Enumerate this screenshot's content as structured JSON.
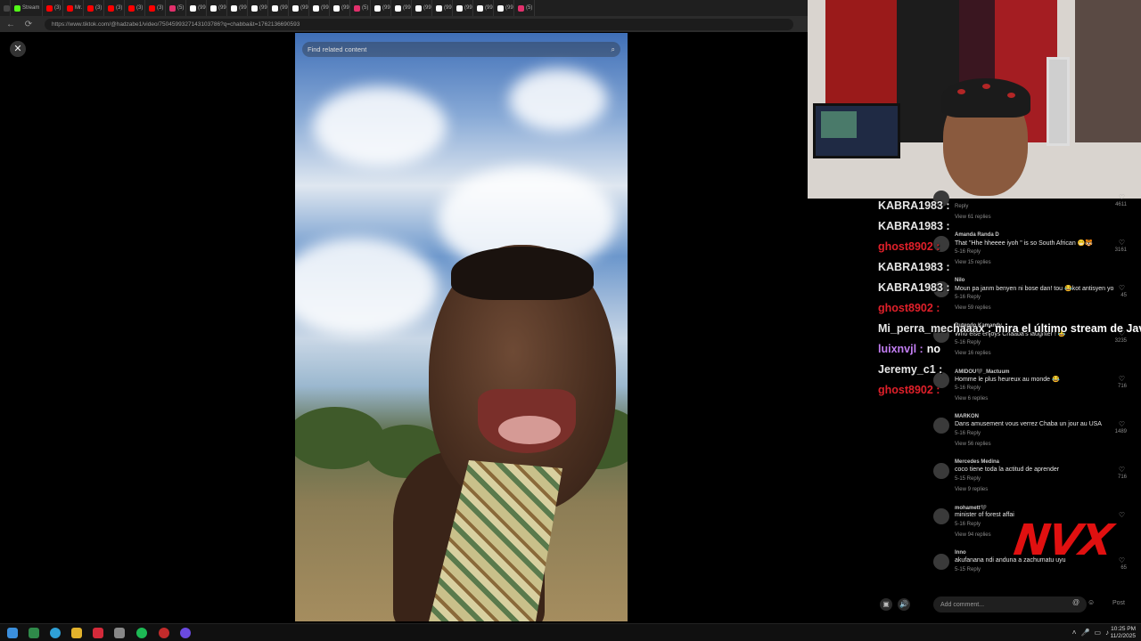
{
  "browser": {
    "tabs": [
      {
        "label": "",
        "icon": "menu-icon",
        "color": "#444444"
      },
      {
        "label": "Stream",
        "icon": "kick-icon",
        "color": "#53fc18"
      },
      {
        "label": "(3) Har",
        "icon": "youtube-icon",
        "color": "#ff0000"
      },
      {
        "label": "Mr.",
        "icon": "youtube-icon",
        "color": "#ff0000"
      },
      {
        "label": "(3) BLA",
        "icon": "youtube-icon",
        "color": "#ff0000"
      },
      {
        "label": "(3) BAE",
        "icon": "youtube-icon",
        "color": "#ff0000"
      },
      {
        "label": "(3) [FR",
        "icon": "youtube-icon",
        "color": "#ff0000"
      },
      {
        "label": "(3) Get",
        "icon": "youtube-icon",
        "color": "#ff0000"
      },
      {
        "label": "(5) Inst",
        "icon": "instagram-icon",
        "color": "#e1306c"
      },
      {
        "label": "(99+) c",
        "icon": "tiktok-icon",
        "color": "#ffffff"
      },
      {
        "label": "(99+)",
        "icon": "tiktok-icon",
        "color": "#ffffff"
      },
      {
        "label": "(99+) E",
        "icon": "tiktok-icon",
        "color": "#ffffff"
      },
      {
        "label": "(99+) E",
        "icon": "tiktok-icon",
        "color": "#ffffff"
      },
      {
        "label": "(99+)",
        "icon": "tiktok-icon",
        "color": "#ffffff"
      },
      {
        "label": "(99+) E",
        "icon": "tiktok-icon",
        "color": "#ffffff"
      },
      {
        "label": "(99+) L",
        "icon": "tiktok-icon",
        "color": "#ffffff"
      },
      {
        "label": "(99+) W",
        "icon": "tiktok-icon",
        "color": "#ffffff"
      },
      {
        "label": "(5) Inst",
        "icon": "instagram-icon",
        "color": "#e1306c"
      },
      {
        "label": "(99+) li",
        "icon": "tiktok-icon",
        "color": "#ffffff"
      },
      {
        "label": "(99+) T",
        "icon": "tiktok-icon",
        "color": "#ffffff"
      },
      {
        "label": "(99+) T",
        "icon": "tiktok-icon",
        "color": "#ffffff"
      },
      {
        "label": "(99+) T",
        "icon": "tiktok-icon",
        "color": "#ffffff"
      },
      {
        "label": "(99+) T",
        "icon": "tiktok-icon",
        "color": "#ffffff"
      },
      {
        "label": "(99+) T",
        "icon": "tiktok-icon",
        "color": "#ffffff"
      },
      {
        "label": "(99+) T",
        "icon": "tiktok-icon",
        "color": "#ffffff"
      },
      {
        "label": "(5) Inst",
        "icon": "instagram-icon",
        "color": "#e1306c"
      }
    ],
    "url": "https://www.tiktok.com/@hadzabe1/video/7504599327143103786?q=chabba&t=1762136690593"
  },
  "video": {
    "search_placeholder": "Find related content",
    "close_label": "✕"
  },
  "chat": [
    {
      "user": "KABRA1983 :",
      "message": "",
      "color": "#e6e6e6"
    },
    {
      "user": "KABRA1983 :",
      "message": "",
      "color": "#e6e6e6"
    },
    {
      "user": "ghost8902 :",
      "message": "",
      "color": "#e0202a"
    },
    {
      "user": "KABRA1983 :",
      "message": "",
      "color": "#e6e6e6"
    },
    {
      "user": "KABRA1983 :",
      "message": "",
      "color": "#e6e6e6"
    },
    {
      "user": "ghost8902 :",
      "message": "",
      "color": "#e0202a"
    },
    {
      "user": "Mi_perra_mechaaax :",
      "message": "mira el último stream de Javi",
      "color": "#e6e6e6"
    },
    {
      "user": "luixnvjl :",
      "message": "no",
      "color": "#c27ef2"
    },
    {
      "user": "Jeremy_c1 :",
      "message": "",
      "color": "#e6e6e6"
    },
    {
      "user": "ghost8902 :",
      "message": "",
      "color": "#e0202a"
    }
  ],
  "comments": [
    {
      "user": "",
      "text": "",
      "meta": "Reply",
      "views": "View 61 replies",
      "likes": "4611"
    },
    {
      "user": "Amanda Randa D",
      "text": "That \"Hhe hheeee iyoh \" is so South African 😁🐯",
      "meta": "5-16   Reply",
      "views": "View 15 replies",
      "likes": "3161"
    },
    {
      "user": "Nilo",
      "text": "Moun pa janm benyen ni bose dan! tou 😂kot antisyen yo",
      "meta": "5-16   Reply",
      "views": "View 59 replies",
      "likes": "45"
    },
    {
      "user": "Rutendo Kamandy",
      "text": "Who else enjoys Chaaba's laughter ! 😂",
      "meta": "5-16   Reply",
      "views": "View 16 replies",
      "likes": "3235"
    },
    {
      "user": "AMIDOU🖤_Mactuum",
      "text": "Homme le plus heureux au monde 😂",
      "meta": "5-16   Reply",
      "views": "View 6 replies",
      "likes": "716"
    },
    {
      "user": "MARKON",
      "text": "Dans amusement vous verrez Chaba un jour au USA",
      "meta": "5-16   Reply",
      "views": "View 56 replies",
      "likes": "1489"
    },
    {
      "user": "Mercedes Medina",
      "text": "coco tiene toda la actitud de aprender",
      "meta": "5-15   Reply",
      "views": "View 9 replies",
      "likes": "716"
    },
    {
      "user": "mohamett🖤",
      "text": "minister of forest affai",
      "meta": "5-16   Reply",
      "views": "View 94 replies",
      "likes": ""
    },
    {
      "user": "Inno",
      "text": "akufanana ndi anduna a zachumatu uyu",
      "meta": "5-15   Reply",
      "views": "",
      "likes": "65"
    }
  ],
  "comment_box": {
    "placeholder": "Add comment...",
    "post_label": "Post"
  },
  "overlay_logo": "NVX",
  "taskbar": {
    "time": "10:25 PM",
    "date": "11/2/2025"
  }
}
